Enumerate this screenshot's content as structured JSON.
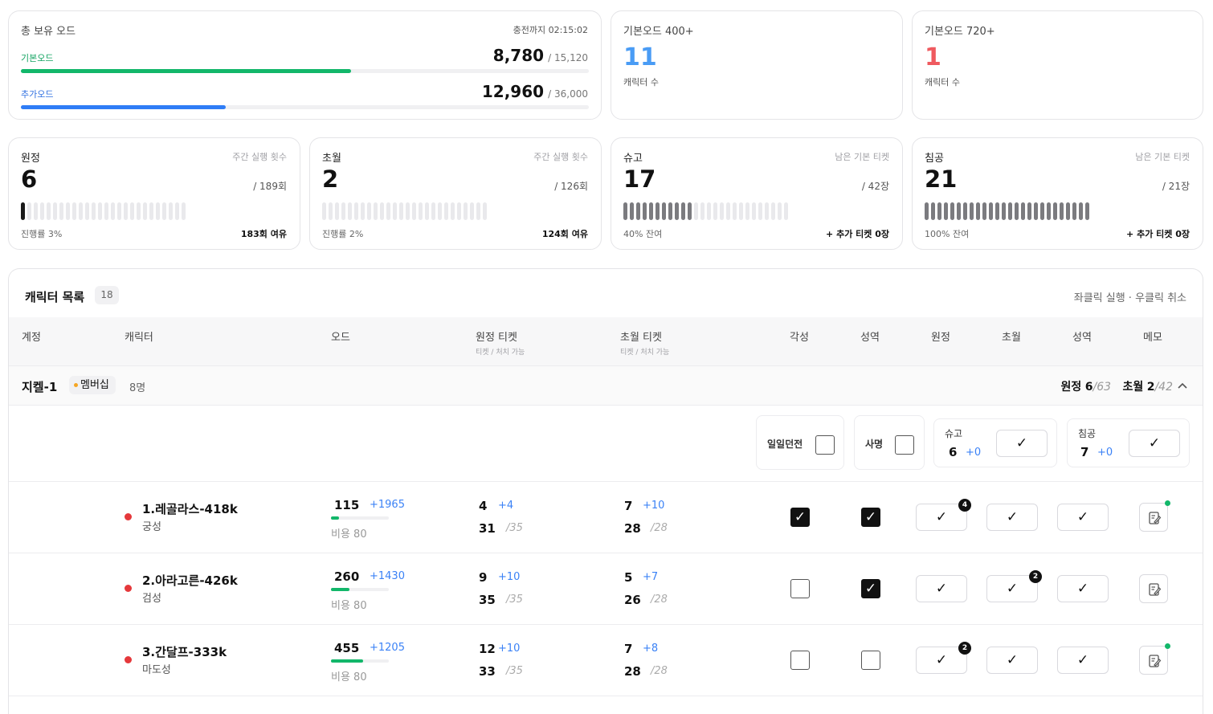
{
  "summary": {
    "title": "총 보유 오드",
    "recharge": "충전까지 02:15:02",
    "base": {
      "label": "기본오드",
      "value": "8,780",
      "max": "/ 15,120",
      "fraction": 0.581
    },
    "extra": {
      "label": "추가오드",
      "value": "12,960",
      "max": "/ 36,000",
      "fraction": 0.36
    }
  },
  "stat400": {
    "label": "기본오드 400+",
    "value": "11",
    "sub": "캐릭터 수",
    "color": "#4a9cf5"
  },
  "stat720": {
    "label": "기본오드 720+",
    "value": "1",
    "sub": "캐릭터 수",
    "color": "#ef5a5f"
  },
  "weekly": [
    {
      "title": "원정",
      "hint": "주간 실행 횟수",
      "value": "6",
      "max": "/ 189회",
      "foot_left": "진행률 3%",
      "foot_right": "183회 여유",
      "filled": 1,
      "segments": 26,
      "style": "dark"
    },
    {
      "title": "초월",
      "hint": "주간 실행 횟수",
      "value": "2",
      "max": "/ 126회",
      "foot_left": "진행률 2%",
      "foot_right": "124회 여유",
      "filled": 0,
      "segments": 26,
      "style": "dark"
    },
    {
      "title": "슈고",
      "hint": "남은 기본 티켓",
      "value": "17",
      "max": "/ 42장",
      "foot_left": "40% 잔여",
      "foot_right": "+ 추가 티켓 0장",
      "filled": 11,
      "segments": 26,
      "style": "gray"
    },
    {
      "title": "침공",
      "hint": "남은 기본 티켓",
      "value": "21",
      "max": "/ 21장",
      "foot_left": "100% 잔여",
      "foot_right": "+ 추가 티켓 0장",
      "filled": 26,
      "segments": 26,
      "style": "gray"
    }
  ],
  "list": {
    "title": "캐릭터 목록",
    "count": "18",
    "hint": "좌클릭 실행 · 우클릭 취소",
    "headers": {
      "account": "계정",
      "character": "캐릭터",
      "od": "오드",
      "expedition_ticket": "원정 티켓",
      "expedition_ticket_sub": "티켓 / 처치 가능",
      "transcend_ticket": "초월 티켓",
      "transcend_ticket_sub": "티켓 / 처치 가능",
      "awaken": "각성",
      "sanctuary": "성역",
      "expedition": "원정",
      "transcend": "초월",
      "sanctuary2": "성역",
      "memo": "메모"
    }
  },
  "group": {
    "name": "지켈-1",
    "membership": "멤버십",
    "members": "8명",
    "exp_label": "원정",
    "exp_value": "6",
    "exp_max": "/63",
    "tr_label": "초월",
    "tr_value": "2",
    "tr_max": "/42",
    "toggles": {
      "daily": "일일던전",
      "mission": "사명"
    },
    "shugo": {
      "label": "슈고",
      "value": "6",
      "plus": "+0"
    },
    "invasion": {
      "label": "침공",
      "value": "7",
      "plus": "+0"
    }
  },
  "rows": [
    {
      "name": "1.레골라스-418k",
      "cls": "궁성",
      "od": "115",
      "od_plus": "+1965",
      "od_fill": 0.14,
      "cost": "비용 80",
      "exp_t": "4",
      "exp_t_plus": "+4",
      "exp_k": "31",
      "exp_k_max": "/35",
      "tr_t": "7",
      "tr_t_plus": "+10",
      "tr_k": "28",
      "tr_k_max": "/28",
      "awaken": true,
      "sanct": true,
      "b1_badge": "4",
      "b2_badge": "",
      "memo_dot": true
    },
    {
      "name": "2.아라고른-426k",
      "cls": "검성",
      "od": "260",
      "od_plus": "+1430",
      "od_fill": 0.32,
      "cost": "비용 80",
      "exp_t": "9",
      "exp_t_plus": "+10",
      "exp_k": "35",
      "exp_k_max": "/35",
      "tr_t": "5",
      "tr_t_plus": "+7",
      "tr_k": "26",
      "tr_k_max": "/28",
      "awaken": false,
      "sanct": true,
      "b1_badge": "",
      "b2_badge": "2",
      "memo_dot": false
    },
    {
      "name": "3.간달프-333k",
      "cls": "마도성",
      "od": "455",
      "od_plus": "+1205",
      "od_fill": 0.56,
      "cost": "비용 80",
      "exp_t": "12",
      "exp_t_plus": "+10",
      "exp_k": "33",
      "exp_k_max": "/35",
      "tr_t": "7",
      "tr_t_plus": "+8",
      "tr_k": "28",
      "tr_k_max": "/28",
      "awaken": false,
      "sanct": false,
      "b1_badge": "2",
      "b2_badge": "",
      "memo_dot": true
    }
  ],
  "icons": {
    "check": "✓",
    "chevron": "chevron-up-icon",
    "memo": "edit-note-icon"
  }
}
